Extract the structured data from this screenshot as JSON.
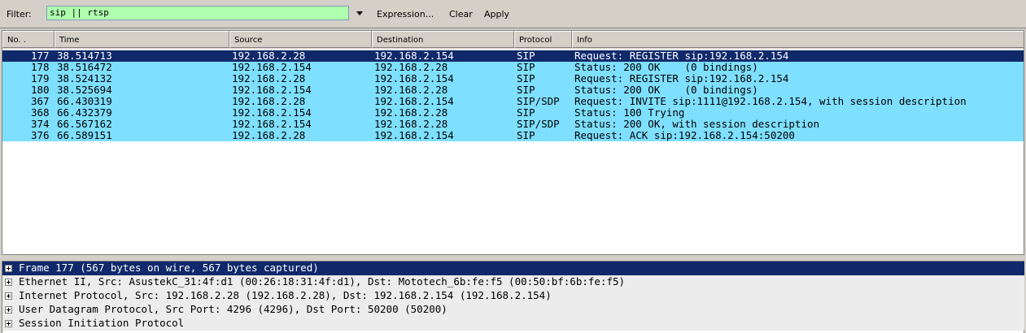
{
  "filter": {
    "label": "Filter:",
    "value": "sip || rtsp",
    "expression_label": "Expression...",
    "clear_label": "Clear",
    "apply_label": "Apply"
  },
  "columns": [
    "No. .",
    "Time",
    "Source",
    "Destination",
    "Protocol",
    "Info"
  ],
  "packets": [
    {
      "no": "177",
      "time": "38.514713",
      "src": "192.168.2.28",
      "dst": "192.168.2.154",
      "proto": "SIP",
      "info": "Request: REGISTER sip:192.168.2.154"
    },
    {
      "no": "178",
      "time": "38.516472",
      "src": "192.168.2.154",
      "dst": "192.168.2.28",
      "proto": "SIP",
      "info": "Status: 200 OK    (0 bindings)"
    },
    {
      "no": "179",
      "time": "38.524132",
      "src": "192.168.2.28",
      "dst": "192.168.2.154",
      "proto": "SIP",
      "info": "Request: REGISTER sip:192.168.2.154"
    },
    {
      "no": "180",
      "time": "38.525694",
      "src": "192.168.2.154",
      "dst": "192.168.2.28",
      "proto": "SIP",
      "info": "Status: 200 OK    (0 bindings)"
    },
    {
      "no": "367",
      "time": "66.430319",
      "src": "192.168.2.28",
      "dst": "192.168.2.154",
      "proto": "SIP/SDP",
      "info": "Request: INVITE sip:1111@192.168.2.154, with session description"
    },
    {
      "no": "368",
      "time": "66.432379",
      "src": "192.168.2.154",
      "dst": "192.168.2.28",
      "proto": "SIP",
      "info": "Status: 100 Trying"
    },
    {
      "no": "374",
      "time": "66.567162",
      "src": "192.168.2.154",
      "dst": "192.168.2.28",
      "proto": "SIP/SDP",
      "info": "Status: 200 OK, with session description"
    },
    {
      "no": "376",
      "time": "66.589151",
      "src": "192.168.2.28",
      "dst": "192.168.2.154",
      "proto": "SIP",
      "info": "Request: ACK sip:192.168.2.154:50200"
    }
  ],
  "details": [
    "Frame 177 (567 bytes on wire, 567 bytes captured)",
    "Ethernet II, Src: AsustekC_31:4f:d1 (00:26:18:31:4f:d1), Dst: Mototech_6b:fe:f5 (00:50:bf:6b:fe:f5)",
    "Internet Protocol, Src: 192.168.2.28 (192.168.2.28), Dst: 192.168.2.154 (192.168.2.154)",
    "User Datagram Protocol, Src Port: 4296 (4296), Dst Port: 50200 (50200)",
    "Session Initiation Protocol"
  ],
  "colors": {
    "row_bg": "#7fdfff",
    "selected_bg": "#10296b",
    "filter_ok_bg": "#afffaf"
  }
}
